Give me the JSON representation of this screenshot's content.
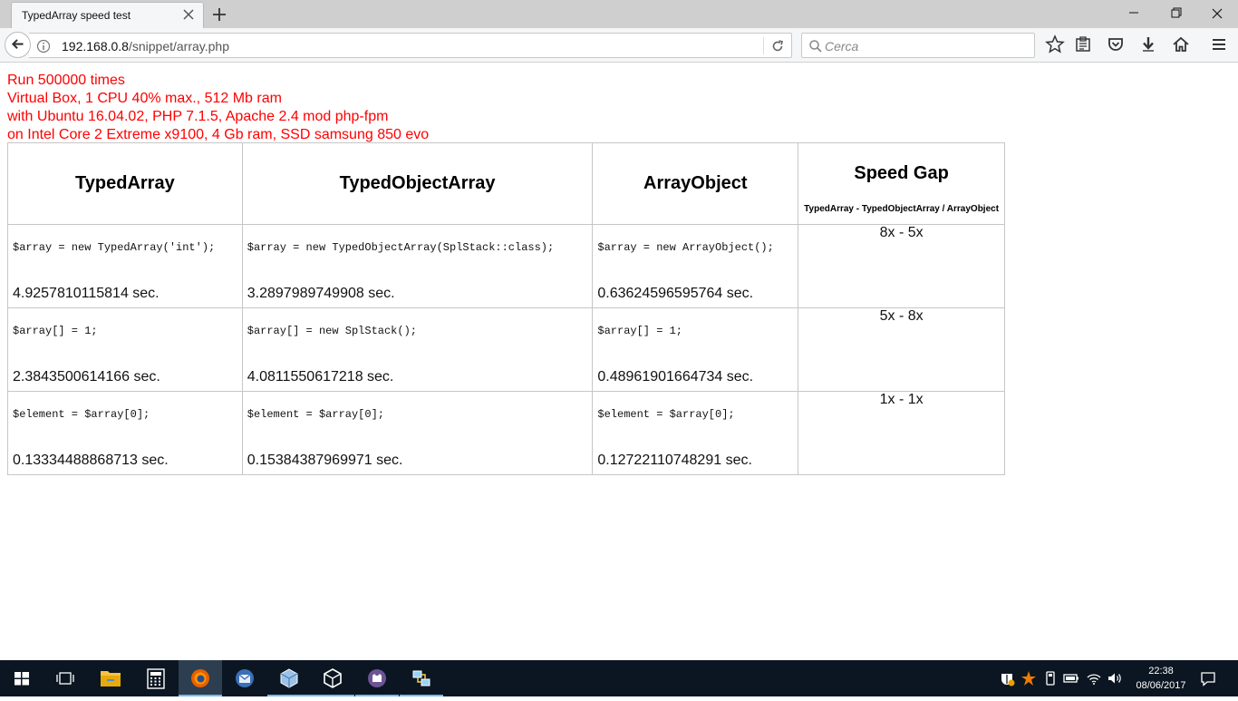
{
  "browser": {
    "tab_title": "TypedArray speed test",
    "url_host": "192.168.0.8",
    "url_path": "/snippet/array.php",
    "search_placeholder": "Cerca"
  },
  "page": {
    "intro_lines": [
      "Run 500000 times",
      "Virtual Box, 1 CPU 40% max., 512 Mb ram",
      "with Ubuntu 16.04.02, PHP 7.1.5, Apache 2.4 mod php-fpm",
      "on Intel Core 2 Extreme x9100, 4 Gb ram, SSD samsung 850 evo"
    ],
    "intro_color": "#ff0000",
    "table": {
      "headers": [
        "TypedArray",
        "TypedObjectArray",
        "ArrayObject"
      ],
      "gap_header": "Speed Gap",
      "gap_subheader": "TypedArray - TypedObjectArray / ArrayObject",
      "rows": [
        {
          "cells": [
            {
              "code": "$array = new TypedArray('int');",
              "time": "4.9257810115814 sec."
            },
            {
              "code": "$array = new TypedObjectArray(SplStack::class);",
              "time": "3.2897989749908 sec."
            },
            {
              "code": "$array = new ArrayObject();",
              "time": "0.63624596595764 sec."
            }
          ],
          "gap": "8x - 5x"
        },
        {
          "cells": [
            {
              "code": "$array[] = 1;",
              "time": "2.3843500614166 sec."
            },
            {
              "code": "$array[] = new SplStack();",
              "time": "4.0811550617218 sec."
            },
            {
              "code": "$array[] = 1;",
              "time": "0.48961901664734 sec."
            }
          ],
          "gap": "5x - 8x"
        },
        {
          "cells": [
            {
              "code": "$element = $array[0];",
              "time": "0.13334488868713 sec."
            },
            {
              "code": "$element = $array[0];",
              "time": "0.15384387969971 sec."
            },
            {
              "code": "$element = $array[0];",
              "time": "0.12722110748291 sec."
            }
          ],
          "gap": "1x - 1x"
        }
      ]
    }
  },
  "taskbar": {
    "clock_time": "22:38",
    "clock_date": "08/06/2017",
    "icons": [
      "windows-start-icon",
      "task-view-icon",
      "file-explorer-icon",
      "calculator-icon",
      "firefox-icon",
      "thunderbird-icon",
      "virtualbox-icon",
      "virtualbox-vm-icon",
      "github-desktop-icon",
      "network-tool-icon"
    ]
  }
}
